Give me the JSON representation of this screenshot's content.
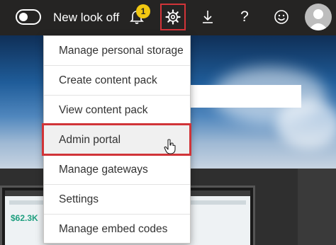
{
  "topbar": {
    "toggle_label": "New look off",
    "notification_count": "1",
    "icons": [
      "toggle-switch-icon",
      "bell-icon",
      "gear-icon",
      "download-icon",
      "question-icon",
      "smiley-icon",
      "avatar-icon"
    ],
    "help_glyph": "?"
  },
  "settings_menu": {
    "items": [
      {
        "label": "Manage personal storage"
      },
      {
        "label": "Create content pack"
      },
      {
        "label": "View content pack"
      },
      {
        "label": "Admin portal",
        "hovered": true
      },
      {
        "label": "Manage gateways"
      },
      {
        "label": "Settings"
      },
      {
        "label": "Manage embed codes"
      }
    ]
  },
  "background": {
    "kpi_value": "$62.3K"
  },
  "colors": {
    "topbar": "#252423",
    "highlight_border": "#d13438",
    "badge": "#f2c811"
  }
}
